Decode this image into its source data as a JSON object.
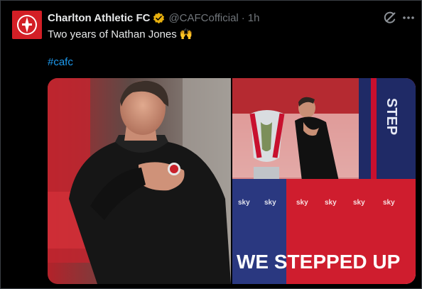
{
  "tweet": {
    "display_name": "Charlton Athletic FC",
    "handle": "@CAFCofficial",
    "separator": "·",
    "time": "1h",
    "text": "Two years of Nathan Jones 🙌",
    "hashtag": "#cafc",
    "verified_color": "#e8b00e"
  },
  "media": {
    "left_photo": "manager-hand-on-chest-photo",
    "right_photo": "trophy-celebration-photo",
    "banner_text": "WE STEPPED UP",
    "board_text": "STEP"
  },
  "icons": [
    "club-crest-icon",
    "verified-badge-icon",
    "grok-icon",
    "more-icon"
  ],
  "colors": {
    "accent": "#1d9bf0",
    "brand": "#d31f26",
    "muted": "#71767b"
  }
}
